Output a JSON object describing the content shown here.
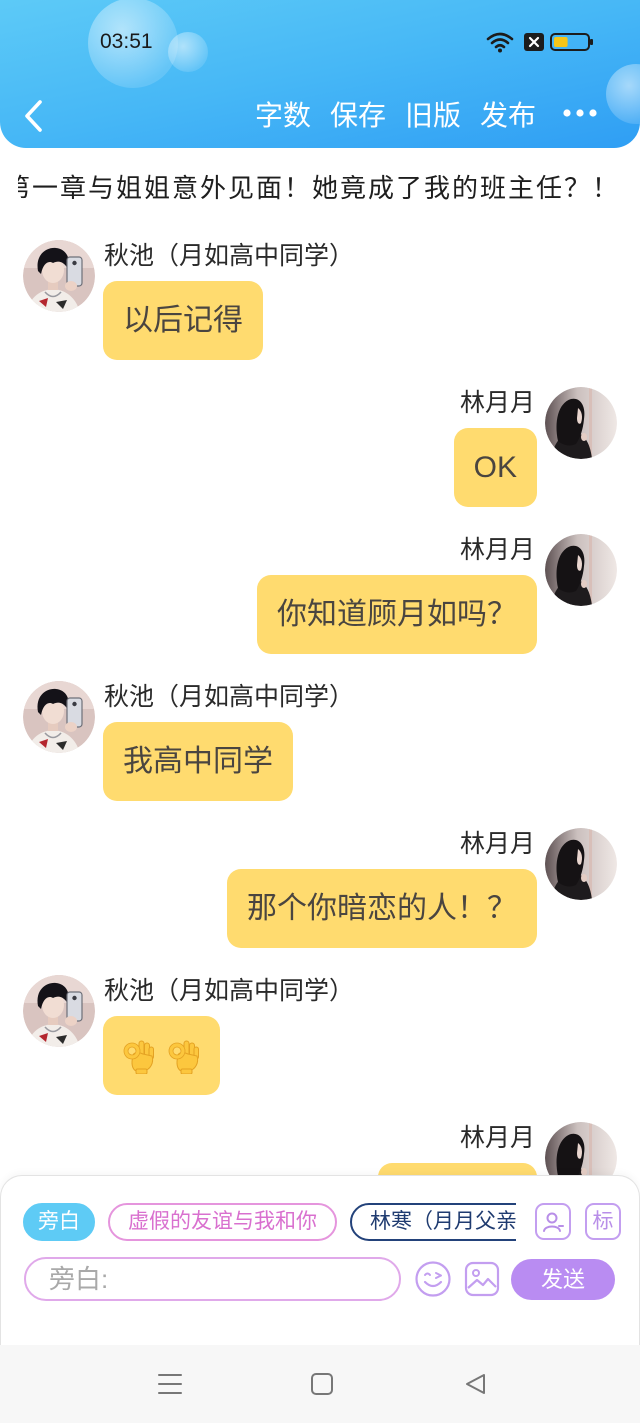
{
  "status_bar": {
    "time": "03:51",
    "icons": [
      "wifi-icon",
      "no-sim-icon",
      "battery-icon"
    ],
    "battery_level_percent": 40
  },
  "header": {
    "back_icon": "chevron-left-icon",
    "actions": [
      "字数",
      "保存",
      "旧版",
      "发布"
    ],
    "more_icon": "more-dots-icon"
  },
  "title": "第一章与姐姐意外见面！她竟成了我的班主任？！",
  "messages": [
    {
      "side": "left",
      "avatar": "boy-photo",
      "name": "秋池（月如高中同学）",
      "text": "以后记得"
    },
    {
      "side": "right",
      "avatar": "girl-photo",
      "name": "林月月",
      "text": "OK"
    },
    {
      "side": "right",
      "avatar": "girl-photo",
      "name": "林月月",
      "text": "你知道顾月如吗？"
    },
    {
      "side": "left",
      "avatar": "boy-photo",
      "name": "秋池（月如高中同学）",
      "text": "我高中同学"
    },
    {
      "side": "right",
      "avatar": "girl-photo",
      "name": "林月月",
      "text": "那个你暗恋的人！？"
    },
    {
      "side": "left",
      "avatar": "boy-photo",
      "name": "秋池（月如高中同学）",
      "content_icons": [
        "ok-hand-icon",
        "ok-hand-icon"
      ]
    },
    {
      "side": "right",
      "avatar": "girl-photo",
      "name": "林月月"
    }
  ],
  "composer": {
    "roles": [
      {
        "label": "旁白",
        "selected": true
      },
      {
        "label": "虚假的友谊与我和你",
        "selected": false
      },
      {
        "label": "林寒（月月父亲）",
        "selected": false
      }
    ],
    "role_icon": "person-card-icon",
    "tag_label": "标",
    "input_placeholder": "旁白:",
    "emoji_icon": "smiley-icon",
    "image_icon": "image-icon",
    "send_label": "发送"
  },
  "system_nav": {
    "icons": [
      "menu-icon",
      "home-square-icon",
      "back-triangle-icon"
    ]
  },
  "colors": {
    "header_start": "#5dcaf7",
    "header_end": "#2f9ef4",
    "bubble": "#ffdb6f",
    "narrator_chip": "#5ecbf5",
    "role_pink": "#e595dd",
    "role_navy": "#23427a",
    "accent_purple": "#b98cf2"
  }
}
